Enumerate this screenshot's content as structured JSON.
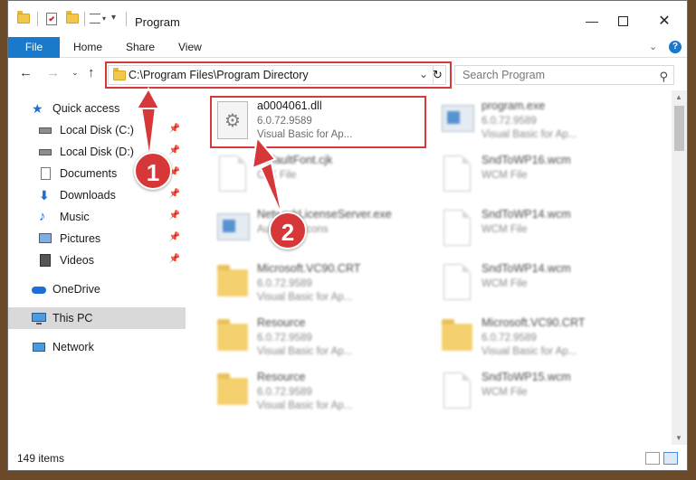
{
  "window": {
    "title": "Program"
  },
  "ribbon": {
    "tabs": [
      {
        "label": "File"
      },
      {
        "label": "Home"
      },
      {
        "label": "Share"
      },
      {
        "label": "View"
      }
    ]
  },
  "address": {
    "path": "C:\\Program Files\\Program Directory",
    "search_placeholder": "Search Program"
  },
  "sidebar": {
    "items": [
      {
        "label": "Quick access",
        "icon": "star-icon"
      },
      {
        "label": "Local Disk (C:)",
        "icon": "drive-icon"
      },
      {
        "label": "Local Disk (D:)",
        "icon": "drive-icon"
      },
      {
        "label": "Documents",
        "icon": "documents-icon"
      },
      {
        "label": "Downloads",
        "icon": "download-icon"
      },
      {
        "label": "Music",
        "icon": "music-icon"
      },
      {
        "label": "Pictures",
        "icon": "pictures-icon"
      },
      {
        "label": "Videos",
        "icon": "videos-icon"
      },
      {
        "label": "OneDrive",
        "icon": "cloud-icon"
      },
      {
        "label": "This PC",
        "icon": "computer-icon"
      },
      {
        "label": "Network",
        "icon": "network-icon"
      }
    ]
  },
  "files": [
    {
      "name": "a0004061.dll",
      "line1": "6.0.72.9589",
      "line2": "Visual Basic for Ap..."
    },
    {
      "name": "program.exe",
      "line1": "6.0.72.9589",
      "line2": "Visual Basic for Ap..."
    },
    {
      "name": "DefaultFont.cjk",
      "line1": "CJK File",
      "line2": ""
    },
    {
      "name": "SndToWP16.wcm",
      "line1": "WCM File",
      "line2": ""
    },
    {
      "name": "NetworkLicenseServer.exe",
      "line1": "Autodesk Icons",
      "line2": ""
    },
    {
      "name": "SndToWP14.wcm",
      "line1": "WCM File",
      "line2": ""
    },
    {
      "name": "Microsoft.VC90.CRT",
      "line1": "6.0.72.9589",
      "line2": "Visual Basic for Ap..."
    },
    {
      "name": "SndToWP14.wcm",
      "line1": "WCM File",
      "line2": ""
    },
    {
      "name": "Resource",
      "line1": "6.0.72.9589",
      "line2": "Visual Basic for Ap..."
    },
    {
      "name": "Microsoft.VC90.CRT",
      "line1": "6.0.72.9589",
      "line2": "Visual Basic for Ap..."
    },
    {
      "name": "Resource",
      "line1": "6.0.72.9589",
      "line2": "Visual Basic for Ap..."
    },
    {
      "name": "SndToWP15.wcm",
      "line1": "WCM File",
      "line2": ""
    }
  ],
  "status": {
    "item_count": "149 items"
  },
  "annotations": {
    "step1": "1",
    "step2": "2"
  },
  "colors": {
    "accent": "#1979ca",
    "highlight": "#d53a3a",
    "selected": "#d9d9d9"
  }
}
